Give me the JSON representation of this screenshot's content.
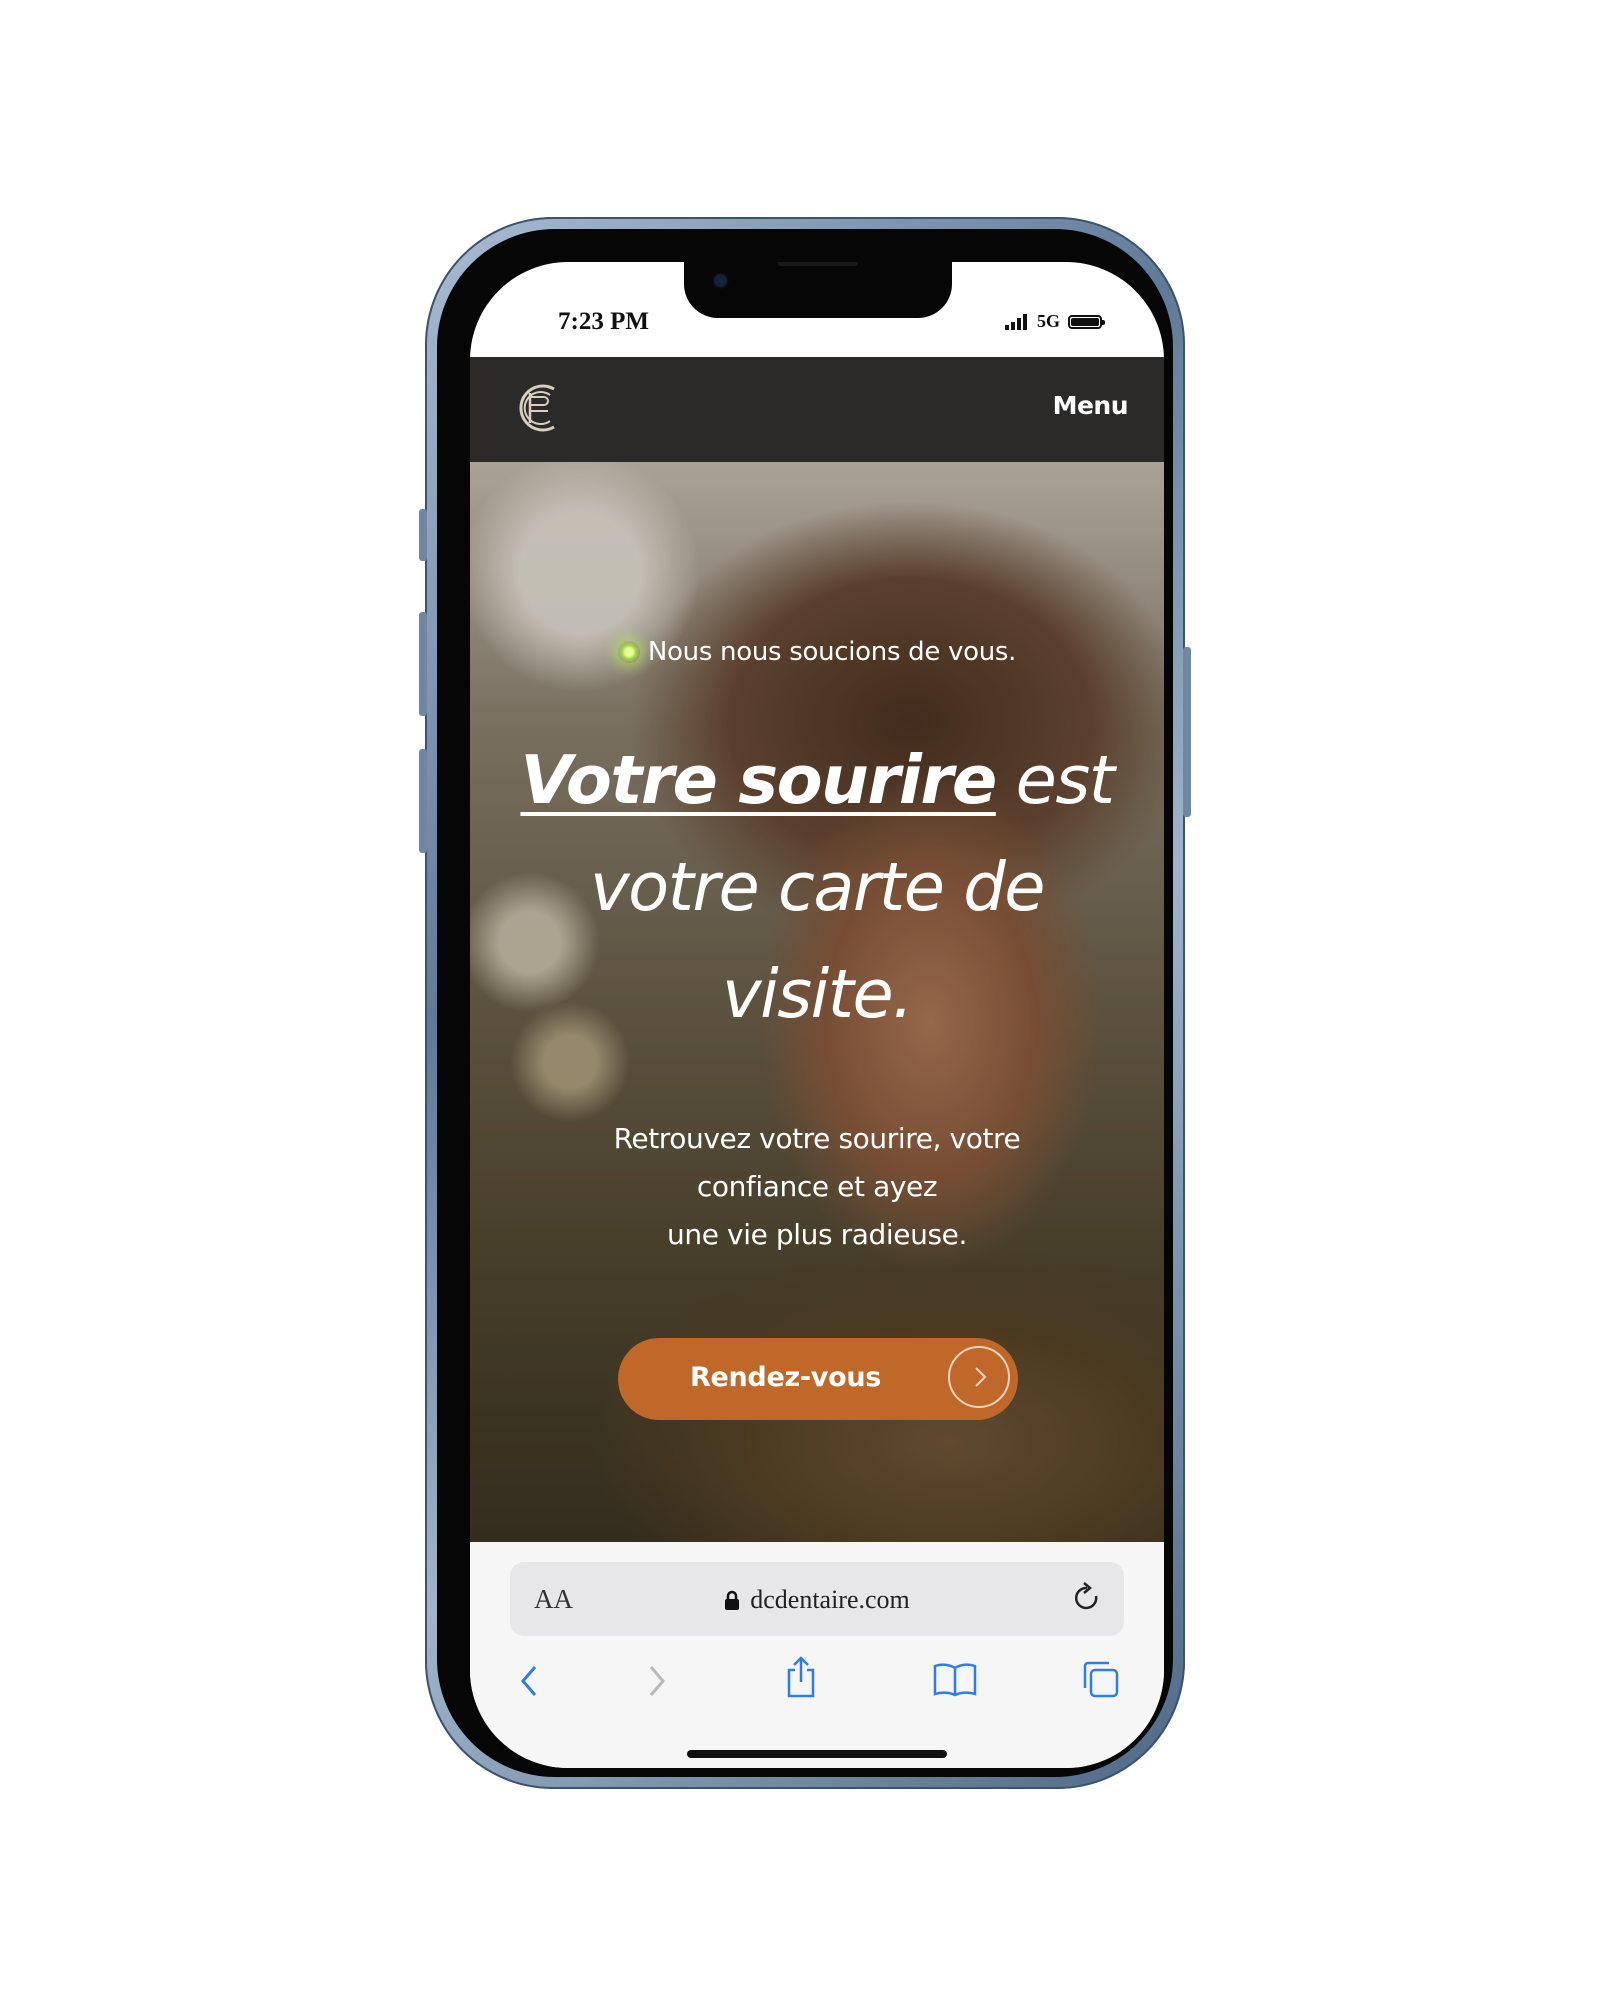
{
  "status_bar": {
    "time": "7:23 PM",
    "network": "5G"
  },
  "header": {
    "logo_icon": "dc-logo-icon",
    "menu_label": "Menu"
  },
  "hero": {
    "tagline": "Nous nous soucions de vous.",
    "headline_strong": "Votre sourire",
    "headline_rest": " est votre carte de visite.",
    "subtext_line1": "Retrouvez votre sourire, votre",
    "subtext_line2": "confiance et ayez",
    "subtext_line3": "une vie plus radieuse.",
    "cta_label": "Rendez-vous",
    "cta_color": "#c0672a"
  },
  "browser": {
    "text_size_label": "AA",
    "url": "dcdentaire.com",
    "accent_color": "#2f7de1",
    "icons": [
      "back-icon",
      "forward-icon",
      "share-icon",
      "bookmarks-icon",
      "tabs-icon"
    ]
  }
}
